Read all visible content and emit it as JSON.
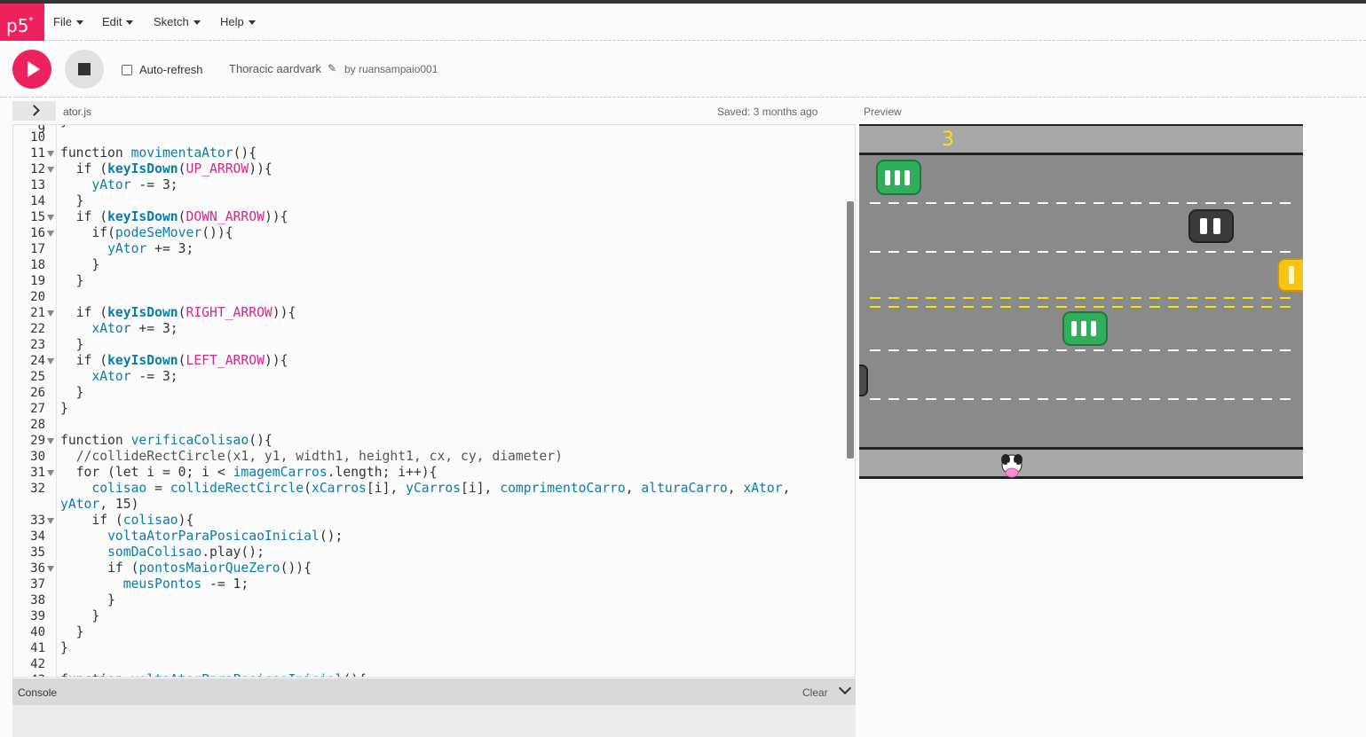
{
  "nav": {
    "logo": "p5",
    "logo_mark": "*",
    "menus": [
      "File",
      "Edit",
      "Sketch",
      "Help"
    ]
  },
  "toolbar": {
    "auto_refresh_label": "Auto-refresh",
    "auto_refresh_checked": false,
    "sketch_name": "Thoracic aardvark",
    "byline": "by ruansampaio001"
  },
  "editor": {
    "filename": "ator.js",
    "saved_status": "Saved: 3 months ago",
    "preview_label": "Preview"
  },
  "console": {
    "label": "Console",
    "clear_label": "Clear"
  },
  "game": {
    "score": "3"
  },
  "colors": {
    "accent": "#ed225d",
    "road": "#8a8a8a",
    "sidewalk": "#a7a7a7",
    "lane_white": "#ffffff",
    "lane_yellow": "#f2e40a",
    "score": "#f7e200"
  }
}
